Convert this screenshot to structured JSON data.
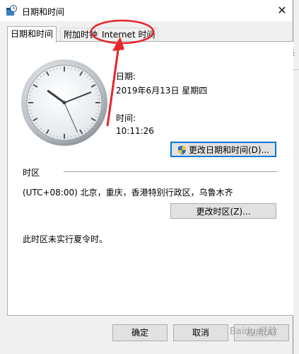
{
  "window": {
    "title": "日期和时间",
    "close_glyph": "✕"
  },
  "tabs": [
    {
      "label": "日期和时间",
      "active": true
    },
    {
      "label": "附加时钟",
      "active": false
    },
    {
      "label": "Internet 时间",
      "active": false
    }
  ],
  "datetime": {
    "date_label": "日期:",
    "date_value": "2019年6月13日 星期四",
    "time_label": "时间:",
    "time_value": "10:11:26",
    "change_button": "更改日期和时间(D)..."
  },
  "timezone": {
    "section_label": "时区",
    "value": "(UTC+08:00) 北京，重庆，香港特别行政区，乌鲁木齐",
    "change_button": "更改时区(Z)...",
    "dst_note": "此时区未实行夏令时。"
  },
  "footer": {
    "ok": "确定",
    "cancel": "取消",
    "apply": "应用(A)"
  },
  "clock": {
    "hours": 10,
    "minutes": 11,
    "seconds": 26
  },
  "background_fragment": "采",
  "watermark": "Baidu 经验",
  "colors": {
    "annotation": "#e8232a",
    "focus": "#0078d7",
    "shield_blue": "#1f6fd1",
    "shield_yellow": "#f2c230"
  },
  "icons": [
    "calendar-clock-icon",
    "close-icon",
    "shield-icon"
  ]
}
